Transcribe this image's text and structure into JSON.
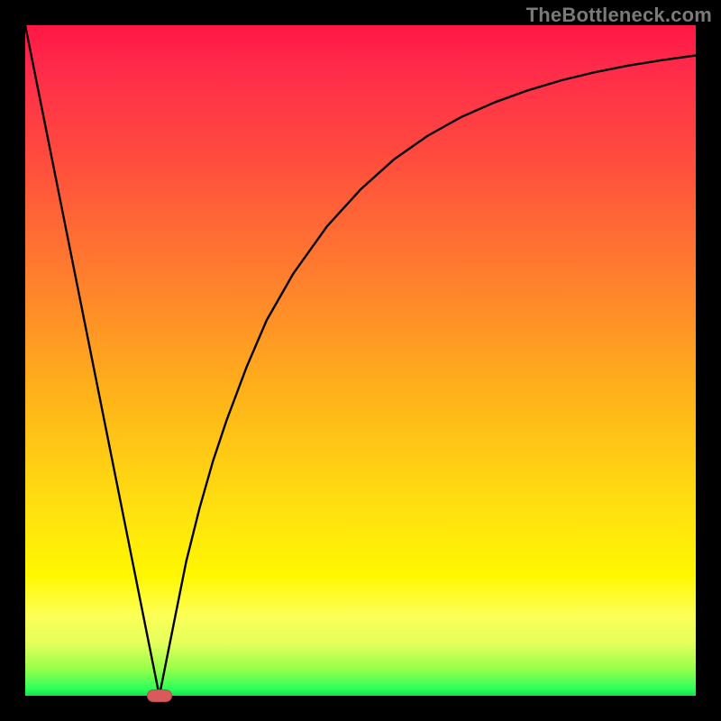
{
  "watermark": {
    "text": "TheBottleneck.com"
  },
  "colors": {
    "frame": "#000000",
    "gradient_top": "#ff1744",
    "gradient_bottom": "#15e04c",
    "curve": "#000000",
    "marker": "#d85a5a"
  },
  "chart_data": {
    "type": "line",
    "title": "",
    "xlabel": "",
    "ylabel": "",
    "xlim": [
      0,
      100
    ],
    "ylim": [
      0,
      100
    ],
    "grid": false,
    "legend": false,
    "annotations": [],
    "marker": {
      "x": 20,
      "y": 0,
      "shape": "pill",
      "color": "#d85a5a"
    },
    "series": [
      {
        "name": "curve",
        "x": [
          0,
          2,
          4,
          6,
          8,
          10,
          12,
          14,
          16,
          18,
          20,
          22,
          24,
          26,
          28,
          30,
          33,
          36,
          40,
          45,
          50,
          55,
          60,
          65,
          70,
          75,
          80,
          85,
          90,
          95,
          100
        ],
        "y": [
          100,
          90,
          80,
          70,
          60,
          50,
          40,
          30,
          20,
          10,
          0,
          10,
          20,
          28,
          35,
          41,
          49,
          56,
          63,
          70,
          75.5,
          80,
          83.5,
          86.3,
          88.5,
          90.3,
          91.8,
          93,
          94,
          94.8,
          95.5
        ]
      }
    ]
  }
}
